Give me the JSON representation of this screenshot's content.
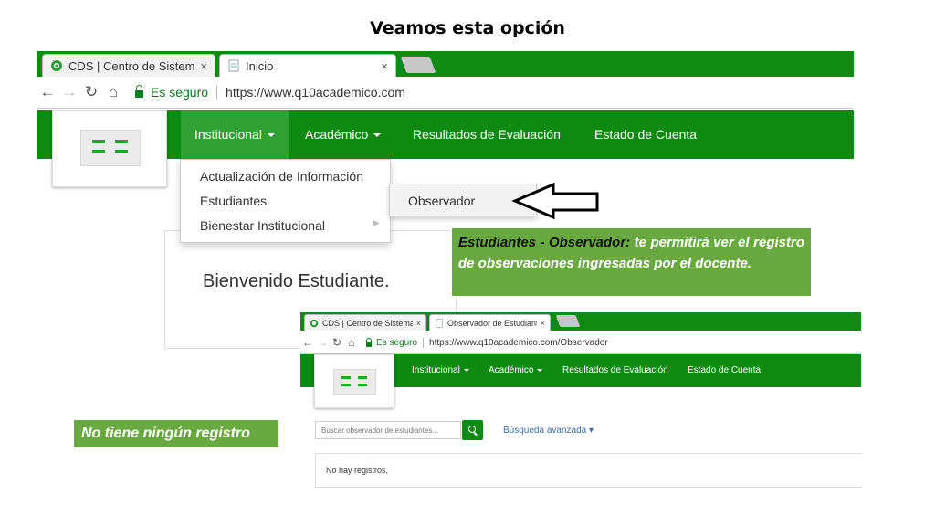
{
  "slide_title": "Veamos esta opción",
  "browser1": {
    "tabs": [
      {
        "label": "CDS | Centro de Sistemas",
        "close": "×",
        "icon": "cds-favicon"
      },
      {
        "label": "Inicio",
        "close": "×",
        "icon": "page-icon"
      }
    ],
    "secure_label": "Es seguro",
    "url": "https://www.q10academico.com",
    "nav": [
      "Institucional",
      "Académico",
      "Resultados de Evaluación",
      "Estado de Cuenta"
    ],
    "dropdown": [
      "Actualización de Información",
      "Estudiantes",
      "Bienestar Institucional"
    ],
    "submenu": "Observador",
    "welcome": "Bienvenido Estudiante."
  },
  "callout": {
    "lead": "Estudiantes - Observador:",
    "text": " te permitirá ver el registro de observaciones  ingresadas por el docente."
  },
  "browser2": {
    "tabs": [
      {
        "label": "CDS | Centro de Sistemas",
        "close": "×",
        "icon": "cds-favicon"
      },
      {
        "label": "Observador de Estudiantes",
        "close": "×",
        "icon": "page-icon"
      }
    ],
    "secure_label": "Es seguro",
    "url": "https://www.q10academico.com/Observador",
    "nav": [
      "Institucional",
      "Académico",
      "Resultados de Evaluación",
      "Estado de Cuenta"
    ],
    "search_placeholder": "Buscar observador de estudiantes...",
    "advanced_search": "Búsqueda avanzada ▾",
    "no_results": "No hay registros,"
  },
  "callout2": "No tiene ningún registro",
  "colors": {
    "nav_green": "#0e8a12",
    "callout_green": "#6aa842",
    "link_blue": "#3a6ea8"
  }
}
